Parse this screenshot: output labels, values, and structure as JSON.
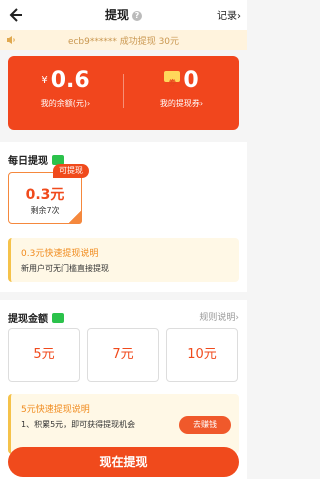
{
  "header": {
    "title": "提现",
    "help_icon": "?",
    "records_label": "记录›"
  },
  "notice": {
    "text": "ecb9****** 成功提现 30元"
  },
  "balance": {
    "currency_symbol": "¥",
    "amount": "0.6",
    "amount_label": "我的余额(元)›",
    "coupons": "0",
    "coupons_label": "我的提现券›"
  },
  "daily": {
    "title": "每日提现",
    "option": {
      "amount": "0.3元",
      "remaining": "剩余7次",
      "ribbon": "可提现"
    },
    "tip_title": "0.3元快速提现说明",
    "tip_body": "新用户可无门槛直接提现"
  },
  "amount_section": {
    "title": "提现金额",
    "rules_label": "规则说明›",
    "options": [
      "5元",
      "7元",
      "10元"
    ],
    "info_title": "5元快速提现说明",
    "info_body": "1、积累5元，即可获得提现机会",
    "earn_button": "去赚钱"
  },
  "footer": {
    "withdraw_button": "现在提现"
  },
  "colors": {
    "accent": "#f04a1c",
    "wechat_green": "#2bc24b",
    "tip_text": "#f08a1c"
  }
}
